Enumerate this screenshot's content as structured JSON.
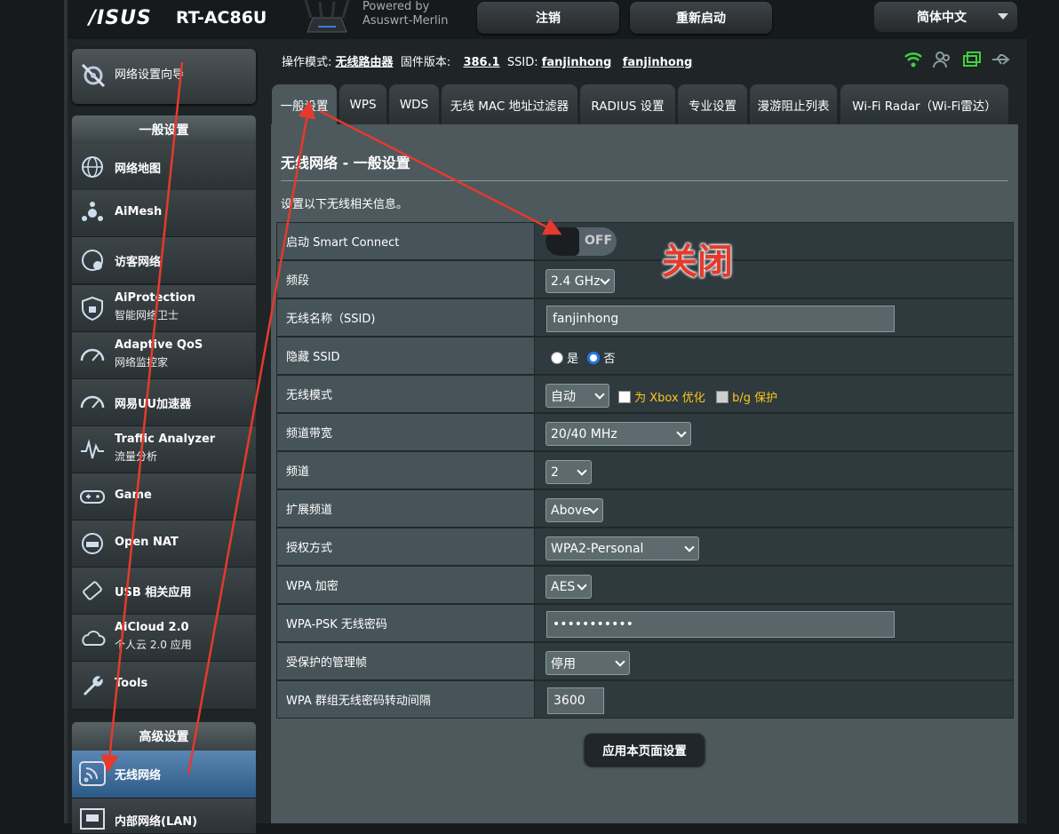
{
  "header": {
    "brand": "/ISUS",
    "model": "RT-AC86U",
    "powered_by": "Powered by",
    "firmware_brand": "Asuswrt-Merlin",
    "logout_label": "注销",
    "reboot_label": "重新启动",
    "language": "简体中文"
  },
  "sidebar": {
    "qis_label": "网络设置向导",
    "general_section": "一般设置",
    "general_items": [
      {
        "line1": "网络地图",
        "line2": "",
        "icon": "globe-map-icon"
      },
      {
        "line1": "AiMesh",
        "line2": "",
        "icon": "aimesh-icon"
      },
      {
        "line1": "访客网络",
        "line2": "",
        "icon": "guest-network-icon"
      },
      {
        "line1": "AiProtection",
        "line2": "智能网络卫士",
        "icon": "shield-lock-icon"
      },
      {
        "line1": "Adaptive QoS",
        "line2": "网络监控家",
        "icon": "speedometer-icon"
      },
      {
        "line1": "网易UU加速器",
        "line2": "",
        "icon": "speedometer-icon"
      },
      {
        "line1": "Traffic Analyzer",
        "line2": "流量分析",
        "icon": "traffic-analyzer-icon"
      },
      {
        "line1": "Game",
        "line2": "",
        "icon": "gamepad-icon"
      },
      {
        "line1": "Open NAT",
        "line2": "",
        "icon": "open-nat-icon"
      },
      {
        "line1": "USB 相关应用",
        "line2": "",
        "icon": "usb-icon"
      },
      {
        "line1": "AiCloud 2.0",
        "line2": "个人云 2.0 应用",
        "icon": "cloud-icon"
      },
      {
        "line1": "Tools",
        "line2": "",
        "icon": "wrench-icon"
      }
    ],
    "advanced_section": "高级设置",
    "advanced_items": [
      {
        "line1": "无线网络",
        "icon": "wireless-icon"
      },
      {
        "line1": "内部网络(LAN)",
        "icon": "lan-icon"
      }
    ]
  },
  "status": {
    "mode_label": "操作模式:",
    "mode_value": "无线路由器",
    "firmware_label": "固件版本:",
    "firmware_value": "386.1",
    "ssid_label": "SSID:",
    "ssid1": "fanjinhong",
    "ssid2": "fanjinhong"
  },
  "tabs": [
    "一般设置",
    "WPS",
    "WDS",
    "无线 MAC 地址过滤器",
    "RADIUS 设置",
    "专业设置",
    "漫游阻止列表",
    "Wi-Fi Radar（Wi-Fi雷达）"
  ],
  "page": {
    "title": "无线网络 - 一般设置",
    "description": "设置以下无线相关信息。"
  },
  "form": {
    "smart_connect_label": "启动 Smart Connect",
    "smart_connect_state": "OFF",
    "band_label": "频段",
    "band_value": "2.4 GHz",
    "ssid_label": "无线名称（SSID)",
    "ssid_value": "fanjinhong",
    "hide_ssid_label": "隐藏 SSID",
    "hide_yes": "是",
    "hide_no": "否",
    "mode_label": "无线模式",
    "mode_value": "自动",
    "xbox_label": "为 Xbox 优化",
    "bg_label": "b/g 保护",
    "bandwidth_label": "频道带宽",
    "bandwidth_value": "20/40 MHz",
    "channel_label": "频道",
    "channel_value": "2",
    "ext_channel_label": "扩展频道",
    "ext_channel_value": "Above",
    "auth_label": "授权方式",
    "auth_value": "WPA2-Personal",
    "wpa_enc_label": "WPA 加密",
    "wpa_enc_value": "AES",
    "psk_label": "WPA-PSK 无线密码",
    "psk_value": "•••••••••••",
    "pmf_label": "受保护的管理帧",
    "pmf_value": "停用",
    "rekey_label": "WPA 群组无线密码转动间隔",
    "rekey_value": "3600",
    "apply_label": "应用本页面设置"
  },
  "annotation": {
    "text": "关闭",
    "color": "#e53a2c"
  },
  "colors": {
    "panel": "#4d595d",
    "label_bg": "#46545a",
    "active_menu": "#2c5a86",
    "option_highlight": "#ffc61e"
  }
}
